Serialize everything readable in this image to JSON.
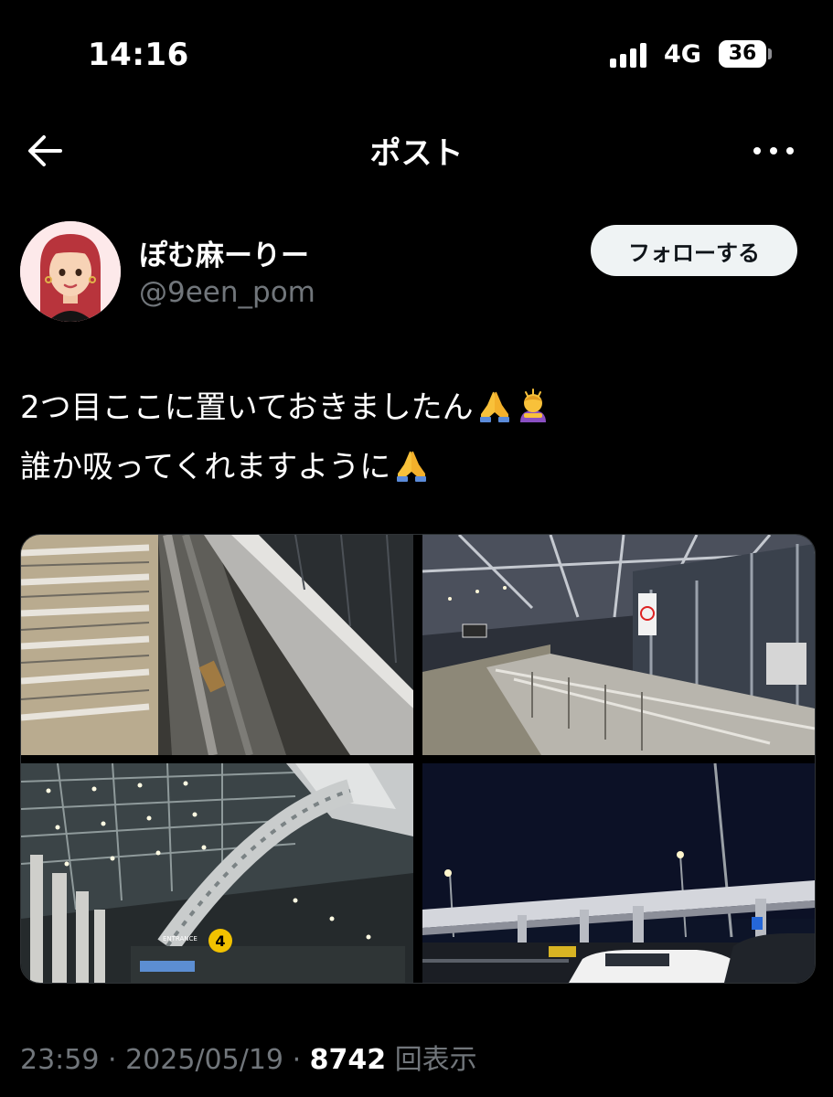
{
  "status_bar": {
    "time": "14:16",
    "network": "4G",
    "battery": "36",
    "signal_icon": "cellular-signal-icon"
  },
  "nav": {
    "title": "ポスト",
    "back_icon": "back-arrow-icon",
    "more_icon": "more-options-icon"
  },
  "author": {
    "display_name": "ぽむ麻ーりー",
    "handle": "@9een_pom",
    "follow_label": "フォローする"
  },
  "post": {
    "line1": "2つ目ここに置いておきましたん",
    "line2": "誰か吸ってくれますように",
    "line1_emojis": [
      "folded-hands-emoji",
      "person-bowing-emoji"
    ],
    "line2_emojis": [
      "folded-hands-emoji"
    ],
    "images": [
      "airport-luggage-carts-closeup",
      "airport-walkway-carts",
      "airport-terminal-roof-entrance",
      "airport-night-road-car"
    ],
    "time": "23:59",
    "date": "2025/05/19",
    "views": "8742",
    "views_label": "回表示"
  },
  "colors": {
    "background": "#000000",
    "text_primary": "#ffffff",
    "text_secondary": "#71767b",
    "follow_button_bg": "#eff3f4"
  }
}
